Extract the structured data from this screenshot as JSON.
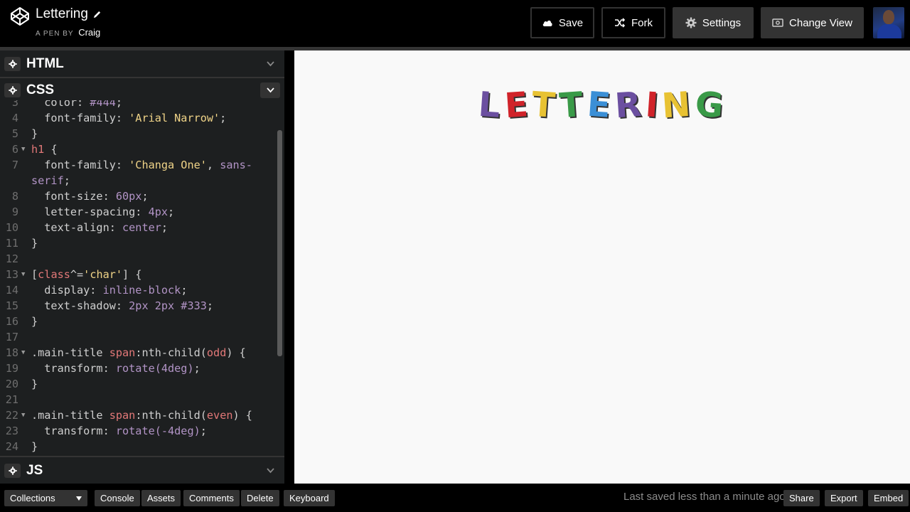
{
  "header": {
    "title": "Lettering",
    "pen_by_prefix": "A PEN BY",
    "author": "Craig",
    "buttons": [
      {
        "label": "Save",
        "icon": "cloud-icon"
      },
      {
        "label": "Fork",
        "icon": "fork-icon"
      },
      {
        "label": "Settings",
        "icon": "gear-icon"
      },
      {
        "label": "Change View",
        "icon": "view-icon"
      }
    ]
  },
  "editors": {
    "html_label": "HTML",
    "css_label": "CSS",
    "js_label": "JS"
  },
  "code_lines": [
    {
      "n": "3",
      "fold": false,
      "parts": [
        [
          "t-prop",
          "  color: "
        ],
        [
          "t-val",
          "#444"
        ],
        [
          "t-plain",
          ";"
        ]
      ]
    },
    {
      "n": "4",
      "fold": false,
      "parts": [
        [
          "t-prop",
          "  font-family: "
        ],
        [
          "t-str",
          "'Arial Narrow'"
        ],
        [
          "t-plain",
          ";"
        ]
      ]
    },
    {
      "n": "5",
      "fold": false,
      "parts": [
        [
          "t-plain",
          "}"
        ]
      ]
    },
    {
      "n": "6",
      "fold": true,
      "parts": [
        [
          "t-sel",
          "h1"
        ],
        [
          "t-plain",
          " {"
        ]
      ]
    },
    {
      "n": "7",
      "fold": false,
      "parts": [
        [
          "t-prop",
          "  font-family: "
        ],
        [
          "t-str",
          "'Changa One'"
        ],
        [
          "t-plain",
          ", "
        ],
        [
          "t-val",
          "sans-"
        ]
      ]
    },
    {
      "n": "",
      "fold": false,
      "parts": [
        [
          "t-val",
          "serif"
        ],
        [
          "t-plain",
          ";"
        ]
      ]
    },
    {
      "n": "8",
      "fold": false,
      "parts": [
        [
          "t-prop",
          "  font-size: "
        ],
        [
          "t-val",
          "60px"
        ],
        [
          "t-plain",
          ";"
        ]
      ]
    },
    {
      "n": "9",
      "fold": false,
      "parts": [
        [
          "t-prop",
          "  letter-spacing: "
        ],
        [
          "t-val",
          "4px"
        ],
        [
          "t-plain",
          ";"
        ]
      ]
    },
    {
      "n": "10",
      "fold": false,
      "parts": [
        [
          "t-prop",
          "  text-align: "
        ],
        [
          "t-val",
          "center"
        ],
        [
          "t-plain",
          ";"
        ]
      ]
    },
    {
      "n": "11",
      "fold": false,
      "parts": [
        [
          "t-plain",
          "}"
        ]
      ]
    },
    {
      "n": "12",
      "fold": false,
      "parts": []
    },
    {
      "n": "13",
      "fold": true,
      "parts": [
        [
          "t-plain",
          "["
        ],
        [
          "t-sel",
          "class"
        ],
        [
          "t-plain",
          "^="
        ],
        [
          "t-str",
          "'char'"
        ],
        [
          "t-plain",
          "] {"
        ]
      ]
    },
    {
      "n": "14",
      "fold": false,
      "parts": [
        [
          "t-prop",
          "  display: "
        ],
        [
          "t-val",
          "inline-block"
        ],
        [
          "t-plain",
          ";"
        ]
      ]
    },
    {
      "n": "15",
      "fold": false,
      "parts": [
        [
          "t-prop",
          "  text-shadow: "
        ],
        [
          "t-val",
          "2px 2px #333"
        ],
        [
          "t-plain",
          ";"
        ]
      ]
    },
    {
      "n": "16",
      "fold": false,
      "parts": [
        [
          "t-plain",
          "}"
        ]
      ]
    },
    {
      "n": "17",
      "fold": false,
      "parts": []
    },
    {
      "n": "18",
      "fold": true,
      "parts": [
        [
          "t-plain",
          ".main-title "
        ],
        [
          "t-sel",
          "span"
        ],
        [
          "t-plain",
          ":nth-child("
        ],
        [
          "t-sel",
          "odd"
        ],
        [
          "t-plain",
          ") {"
        ]
      ]
    },
    {
      "n": "19",
      "fold": false,
      "parts": [
        [
          "t-prop",
          "  transform: "
        ],
        [
          "t-val",
          "rotate(4deg)"
        ],
        [
          "t-plain",
          ";"
        ]
      ]
    },
    {
      "n": "20",
      "fold": false,
      "parts": [
        [
          "t-plain",
          "}"
        ]
      ]
    },
    {
      "n": "21",
      "fold": false,
      "parts": []
    },
    {
      "n": "22",
      "fold": true,
      "parts": [
        [
          "t-plain",
          ".main-title "
        ],
        [
          "t-sel",
          "span"
        ],
        [
          "t-plain",
          ":nth-child("
        ],
        [
          "t-sel",
          "even"
        ],
        [
          "t-plain",
          ") {"
        ]
      ]
    },
    {
      "n": "23",
      "fold": false,
      "parts": [
        [
          "t-prop",
          "  transform: "
        ],
        [
          "t-val",
          "rotate(-4deg)"
        ],
        [
          "t-plain",
          ";"
        ]
      ]
    },
    {
      "n": "24",
      "fold": false,
      "parts": [
        [
          "t-plain",
          "}"
        ]
      ]
    }
  ],
  "preview": {
    "letters": [
      {
        "ch": "L",
        "color": "#6b4fa0",
        "rot": 4
      },
      {
        "ch": "E",
        "color": "#d0232a",
        "rot": -4
      },
      {
        "ch": "T",
        "color": "#e8c233",
        "rot": 4
      },
      {
        "ch": "T",
        "color": "#3a9a48",
        "rot": -4
      },
      {
        "ch": "E",
        "color": "#3b8fd6",
        "rot": 4
      },
      {
        "ch": "R",
        "color": "#6b4fa0",
        "rot": -4
      },
      {
        "ch": "I",
        "color": "#d0232a",
        "rot": 4
      },
      {
        "ch": "N",
        "color": "#e8c233",
        "rot": -4
      },
      {
        "ch": "G",
        "color": "#3a9a48",
        "rot": 4
      }
    ]
  },
  "footer": {
    "collections": "Collections",
    "buttons": [
      "Console",
      "Assets",
      "Comments",
      "Delete",
      "Keyboard"
    ],
    "saved_status": "Last saved less than a minute ago",
    "right_buttons": [
      "Share",
      "Export",
      "Embed"
    ]
  }
}
